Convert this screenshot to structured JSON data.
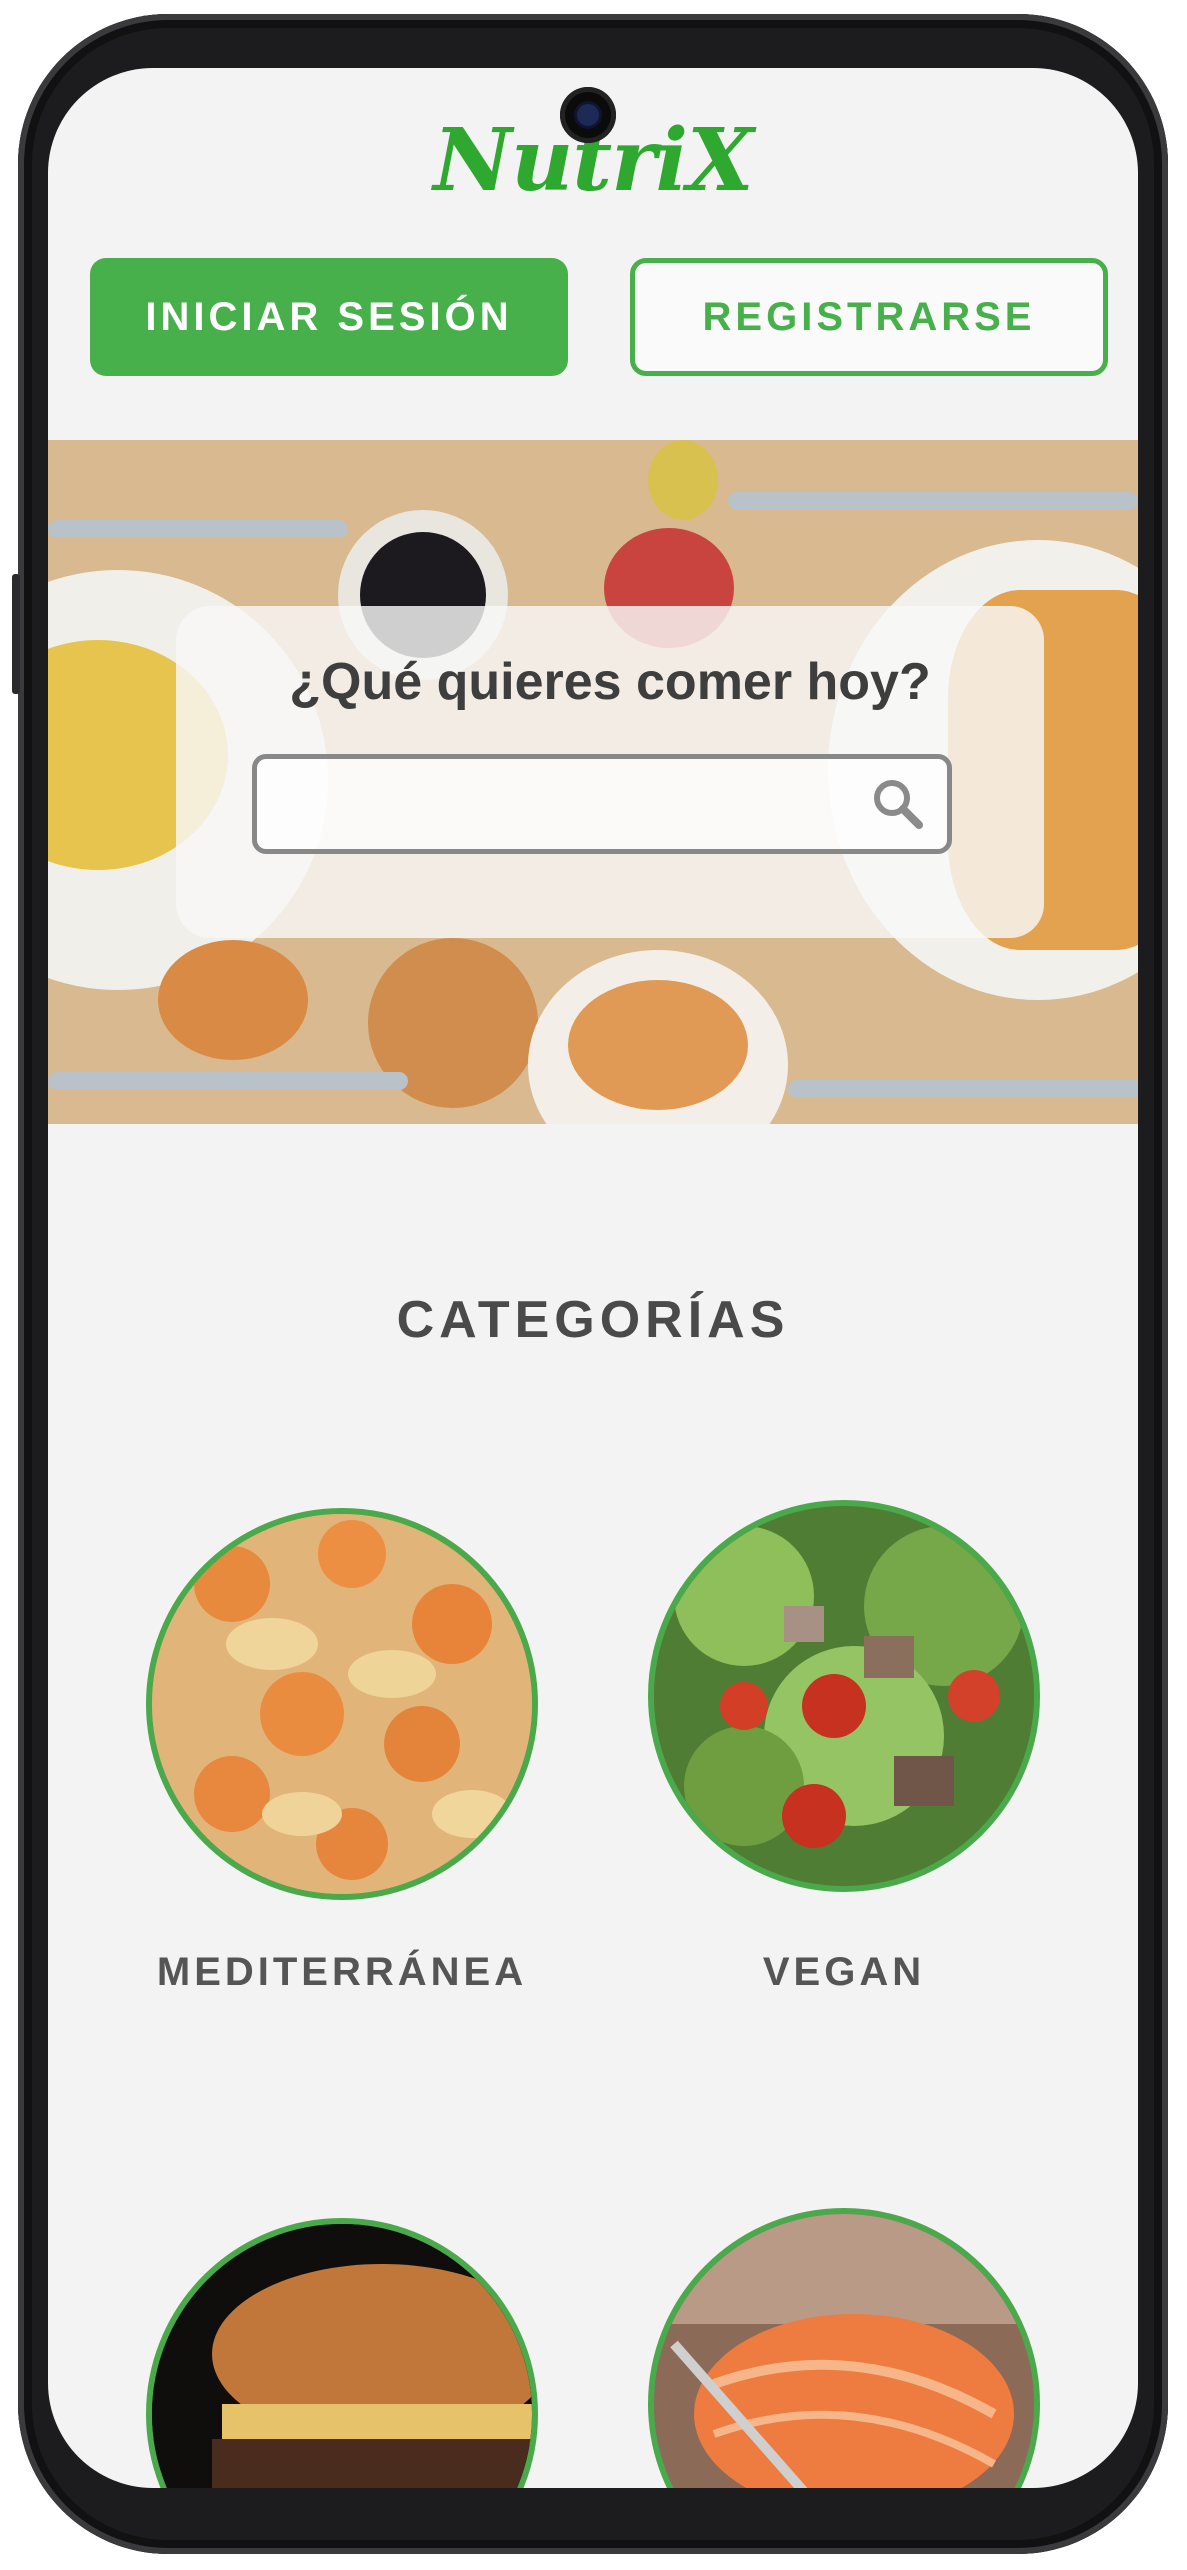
{
  "app": {
    "logo_text": "NutriX",
    "brand_color": "#48b04a"
  },
  "header": {
    "login_label": "INICIAR SESIÓN",
    "register_label": "REGISTRARSE"
  },
  "hero": {
    "search_title": "¿Qué quieres comer hoy?",
    "search_value": "",
    "search_icon": "search-icon"
  },
  "categories": {
    "title": "CATEGORÍAS",
    "items": [
      {
        "label": "MEDITERRÁNEA",
        "image": "shrimp-pasta"
      },
      {
        "label": "VEGAN",
        "image": "salad"
      },
      {
        "label": "",
        "image": "burger"
      },
      {
        "label": "",
        "image": "sushi"
      }
    ]
  }
}
